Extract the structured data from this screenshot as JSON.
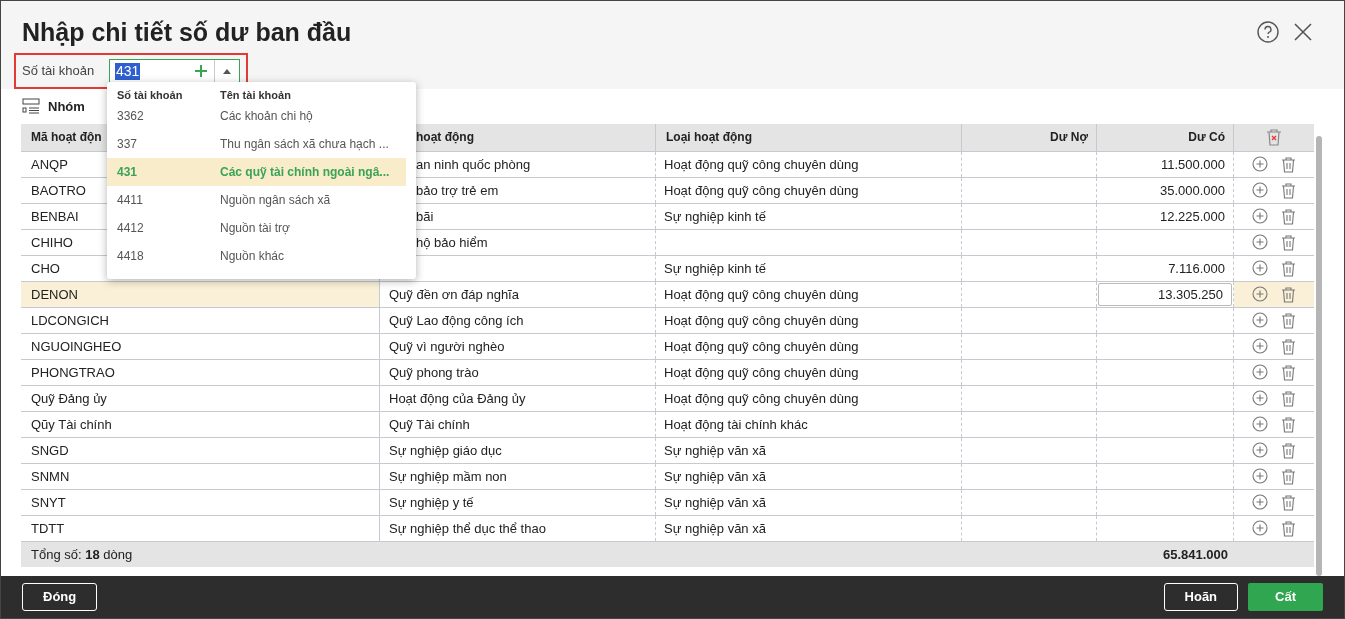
{
  "title": "Nhập chi tiết số dư ban đầu",
  "account_field": {
    "label": "Số tài khoản",
    "value": "431"
  },
  "dropdown": {
    "columns": [
      "Số tài khoản",
      "Tên tài khoản"
    ],
    "items": [
      {
        "number": "3362",
        "name": "Các khoản chi hộ",
        "selected": false
      },
      {
        "number": "337",
        "name": "Thu ngân sách xã chưa hạch ...",
        "selected": false
      },
      {
        "number": "431",
        "name": "Các quỹ tài chính ngoài ngâ...",
        "selected": true
      },
      {
        "number": "4411",
        "name": "Nguồn ngân sách xã",
        "selected": false
      },
      {
        "number": "4412",
        "name": "Nguồn tài trợ",
        "selected": false
      },
      {
        "number": "4418",
        "name": "Nguồn khác",
        "selected": false
      }
    ]
  },
  "group_button": "Nhóm",
  "table": {
    "columns": [
      {
        "label": "Mã hoạt độn"
      },
      {
        "label": "hoạt động",
        "covered": true
      },
      {
        "label": "Loại hoạt động"
      },
      {
        "label": "Dư Nợ"
      },
      {
        "label": "Dư Có"
      }
    ],
    "rows": [
      {
        "code": "ANQP",
        "name": "an ninh quốc phòng",
        "covered": true,
        "type": "Hoạt động quỹ công chuyên dùng",
        "credit": "11.500.000",
        "selected": false
      },
      {
        "code": "BAOTRO",
        "name": "bảo trợ trẻ em",
        "covered": true,
        "type": "Hoạt động quỹ công chuyên dùng",
        "credit": "35.000.000",
        "selected": false
      },
      {
        "code": "BENBAI",
        "name": "bãi",
        "covered": true,
        "type": "Sự nghiệp kinh tế",
        "credit": "12.225.000",
        "selected": false
      },
      {
        "code": "CHIHO",
        "name": "hộ bảo hiểm",
        "covered": true,
        "selected": false
      },
      {
        "code": "CHO",
        "type": "Sự nghiệp kinh tế",
        "credit": "7.116.000",
        "selected": false
      },
      {
        "code": "DENON",
        "name": "Quỹ đền ơn đáp nghĩa",
        "type": "Hoạt động quỹ công chuyên dùng",
        "credit": "13.305.250",
        "selected": true
      },
      {
        "code": "LDCONGICH",
        "name": "Quỹ Lao động công ích",
        "type": "Hoạt động quỹ công chuyên dùng",
        "selected": false
      },
      {
        "code": "NGUOINGHEO",
        "name": "Quỹ vì người nghèo",
        "type": "Hoạt động quỹ công chuyên dùng",
        "selected": false
      },
      {
        "code": "PHONGTRAO",
        "name": "Quỹ phong trào",
        "type": "Hoạt động quỹ công chuyên dùng",
        "selected": false
      },
      {
        "code": "Quỹ Đảng ủy",
        "name": "Hoạt động của Đảng ủy",
        "type": "Hoạt động quỹ công chuyên dùng",
        "selected": false
      },
      {
        "code": "Qũy Tài chính",
        "name": "Quỹ Tài chính",
        "type": "Hoạt động tài chính khác",
        "selected": false
      },
      {
        "code": "SNGD",
        "name": "Sự nghiệp giáo dục",
        "type": "Sự nghiệp văn xã",
        "selected": false
      },
      {
        "code": "SNMN",
        "name": "Sự nghiệp mầm non",
        "type": "Sự nghiệp văn xã",
        "selected": false
      },
      {
        "code": "SNYT",
        "name": "Sự nghiệp y tế",
        "type": "Sự nghiệp văn xã",
        "selected": false
      },
      {
        "code": "TDTT",
        "name": "Sự nghiệp thể dục thể thao",
        "type": "Sự nghiệp văn xã",
        "selected": false
      }
    ],
    "total_label": "Tổng số: **18** dòng",
    "total_credit": "65.841.000"
  },
  "buttons": [
    {
      "label": "Đóng",
      "kind": "secondary"
    },
    {
      "label": "Hoãn",
      "kind": "secondary"
    },
    {
      "label": "Cất",
      "kind": "primary"
    }
  ]
}
